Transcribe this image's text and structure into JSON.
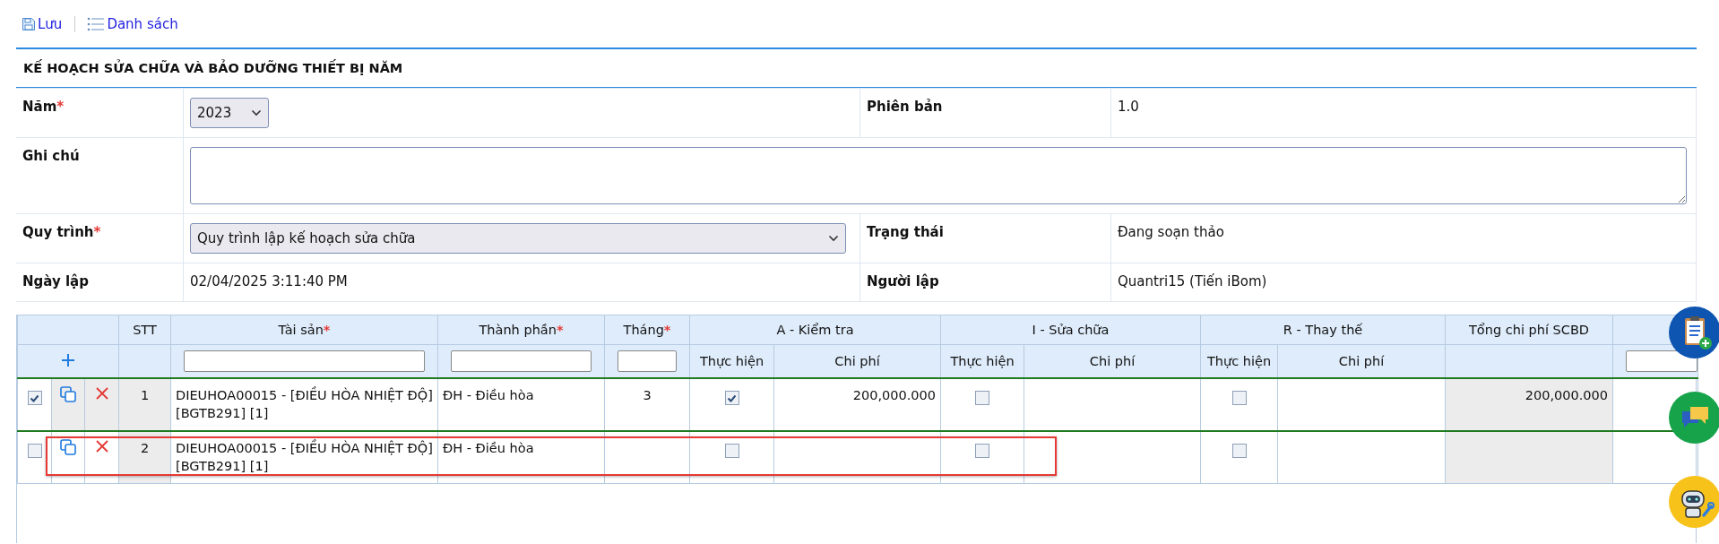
{
  "toolbar": [
    {
      "kind": "save",
      "label": "Lưu"
    },
    {
      "kind": "list",
      "label": "Danh sách"
    }
  ],
  "form": {
    "title": "KẾ HOẠCH SỬA CHỮA VÀ BẢO DƯỠNG THIẾT BỊ NĂM",
    "rows": [
      {
        "fields": [
          {
            "label": "Năm",
            "mark": "*",
            "kind": "select-small",
            "value": "2023"
          },
          {
            "label": "Phiên bản",
            "kind": "text",
            "value": "1.0"
          }
        ]
      },
      {
        "fields": [
          {
            "label": "Ghi chú",
            "kind": "textarea"
          }
        ]
      },
      {
        "fields": [
          {
            "label": "Quy trình",
            "mark": "*",
            "kind": "select",
            "value": "Quy trình lập kế hoạch sửa chữa"
          },
          {
            "label": "Trạng thái",
            "kind": "text",
            "value": "Đang soạn thảo"
          }
        ]
      },
      {
        "fields": [
          {
            "label": "Ngày lập",
            "kind": "text",
            "value": "02/04/2025 3:11:40 PM"
          },
          {
            "label": "Người lập",
            "kind": "text",
            "value": "Quantri15 (Tiến iBom)"
          }
        ]
      }
    ]
  },
  "grid": {
    "columns": [
      {
        "label": "STT",
        "filter": false
      },
      {
        "label": "Tài sản",
        "mark": "*",
        "filter": true
      },
      {
        "label": "Thành phần",
        "mark": "*",
        "filter": true
      },
      {
        "label": "Tháng",
        "mark": "*",
        "filter": true
      }
    ],
    "groups": [
      {
        "label": "A - Kiểm tra",
        "sub": [
          "Thực hiện",
          "Chi phí"
        ]
      },
      {
        "label": "I - Sửa chữa",
        "sub": [
          "Thực hiện",
          "Chi phí"
        ]
      },
      {
        "label": "R - Thay thế",
        "sub": [
          "Thực hiện",
          "Chi phí"
        ]
      }
    ],
    "total_column": {
      "label": "Tổng chi phí SCBD"
    },
    "rows": [
      {
        "selected": true,
        "highlighted": false,
        "stt": "1",
        "asset": "DIEUHOA00015 - [ĐIỀU HÒA NHIỆT ĐỘ] [BGTB291] [1]",
        "component": "ĐH - Điều hòa",
        "month": "3",
        "groups": [
          {
            "done": true,
            "cost": "200,000.000"
          },
          {
            "done": false
          },
          {
            "done": false
          }
        ],
        "total": "200,000.000"
      },
      {
        "selected": false,
        "highlighted": true,
        "stt": "2",
        "asset": "DIEUHOA00015 - [ĐIỀU HÒA NHIỆT ĐỘ] [BGTB291] [1]",
        "component": "ĐH - Điều hòa",
        "groups": [
          {
            "done": false
          },
          {
            "done": false
          },
          {
            "done": false
          }
        ]
      }
    ]
  }
}
